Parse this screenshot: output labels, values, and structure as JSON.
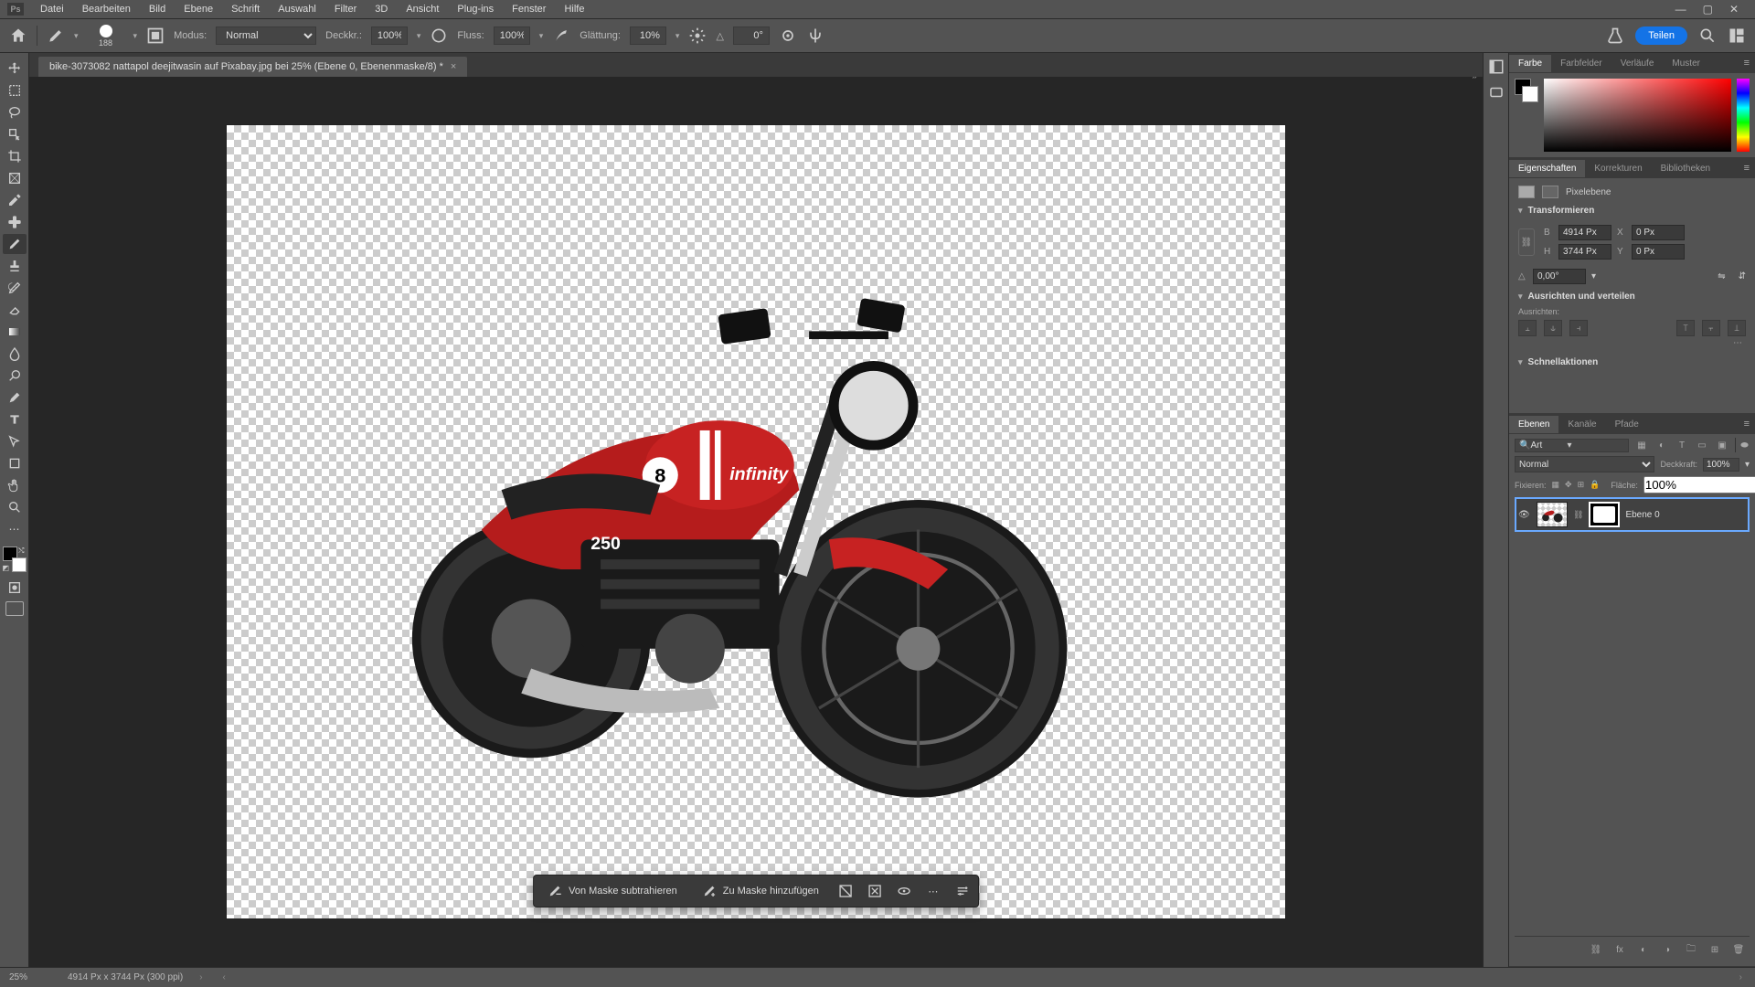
{
  "menu": {
    "items": [
      "Datei",
      "Bearbeiten",
      "Bild",
      "Ebene",
      "Schrift",
      "Auswahl",
      "Filter",
      "3D",
      "Ansicht",
      "Plug-ins",
      "Fenster",
      "Hilfe"
    ]
  },
  "options": {
    "brush_size": "188",
    "mode_label": "Modus:",
    "mode_value": "Normal",
    "opacity_label": "Deckkr.:",
    "opacity_value": "100%",
    "flow_label": "Fluss:",
    "flow_value": "100%",
    "smoothing_label": "Glättung:",
    "smoothing_value": "10%",
    "angle_label": "△",
    "angle_value": "0°",
    "share_label": "Teilen"
  },
  "document": {
    "tab_title": "bike-3073082 nattapol deejitwasin auf Pixabay.jpg bei 25% (Ebene 0, Ebenenmaske/8) *"
  },
  "contextbar": {
    "subtract": "Von Maske subtrahieren",
    "add": "Zu Maske hinzufügen"
  },
  "panels": {
    "color": {
      "tabs": [
        "Farbe",
        "Farbfelder",
        "Verläufe",
        "Muster"
      ]
    },
    "properties": {
      "tabs": [
        "Eigenschaften",
        "Korrekturen",
        "Bibliotheken"
      ],
      "layer_type": "Pixelebene",
      "transform_title": "Transformieren",
      "w_label": "B",
      "w_value": "4914 Px",
      "h_label": "H",
      "h_value": "3744 Px",
      "x_label": "X",
      "x_value": "0 Px",
      "y_label": "Y",
      "y_value": "0 Px",
      "angle_value": "0,00°",
      "align_title": "Ausrichten und verteilen",
      "align_sub": "Ausrichten:",
      "quick_title": "Schnellaktionen"
    },
    "layers": {
      "tabs": [
        "Ebenen",
        "Kanäle",
        "Pfade"
      ],
      "filter_kind": "Art",
      "blend_mode": "Normal",
      "opacity_label": "Deckkraft:",
      "opacity_value": "100%",
      "lock_label": "Fixieren:",
      "fill_label": "Fläche:",
      "fill_value": "100%",
      "layer0_name": "Ebene 0"
    }
  },
  "status": {
    "zoom": "25%",
    "doc_dims": "4914 Px x 3744 Px (300 ppi)"
  }
}
